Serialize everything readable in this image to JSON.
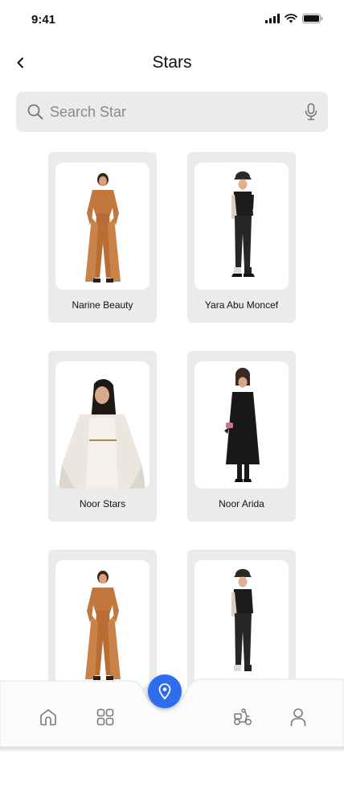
{
  "status": {
    "time": "9:41"
  },
  "header": {
    "title": "Stars"
  },
  "search": {
    "placeholder": "Search Star"
  },
  "stars": [
    {
      "name": "Narine Beauty",
      "outfit": "camel-leather"
    },
    {
      "name": "Yara Abu Moncef",
      "outfit": "black-leather"
    },
    {
      "name": "Noor Stars",
      "outfit": "white-dress"
    },
    {
      "name": "Noor Arida",
      "outfit": "black-coat"
    },
    {
      "name": "",
      "outfit": "camel-leather"
    },
    {
      "name": "",
      "outfit": "black-leather"
    }
  ],
  "tabbar": {
    "items": [
      "home-icon",
      "grid-icon",
      "location-pin-icon",
      "delivery-scooter-icon",
      "user-icon"
    ],
    "accent": "#2f6df0"
  },
  "colors": {
    "card_bg": "#ebebeb",
    "search_bg": "#ebebeb",
    "camel": "#c2773c",
    "black_outfit": "#1c1c1c"
  }
}
